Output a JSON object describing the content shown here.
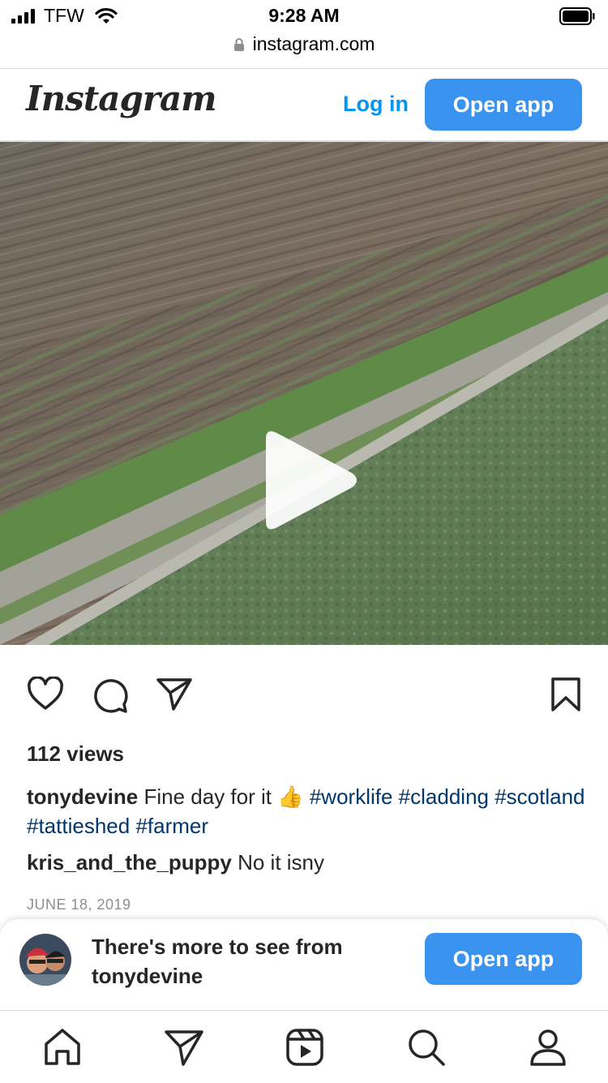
{
  "status_bar": {
    "carrier": "TFW",
    "time": "9:28 AM"
  },
  "browser": {
    "url": "instagram.com"
  },
  "header": {
    "logo": "Instagram",
    "login_label": "Log in",
    "open_app_label": "Open app"
  },
  "post": {
    "views": "112 views",
    "caption": {
      "username": "tonydevine",
      "text": "Fine day for it",
      "emoji": "👍",
      "hashtags": [
        "#worklife",
        "#cladding",
        "#scotland",
        "#tattieshed",
        "#farmer"
      ]
    },
    "comment": {
      "username": "kris_and_the_puppy",
      "text": "No it isny"
    },
    "date": "JUNE 18, 2019"
  },
  "banner": {
    "line1": "There's more to see from",
    "username": "tonydevine",
    "open_app_label": "Open app"
  },
  "icons": {
    "action_bar": [
      "heart-icon",
      "comment-icon",
      "share-icon",
      "bookmark-icon"
    ],
    "nav": [
      "home-icon",
      "direct-icon",
      "reels-icon",
      "search-icon",
      "profile-icon"
    ]
  },
  "colors": {
    "accent": "#3b93f0",
    "link": "#0095f6",
    "hashtag": "#00376b",
    "muted": "#8e8e8e"
  }
}
